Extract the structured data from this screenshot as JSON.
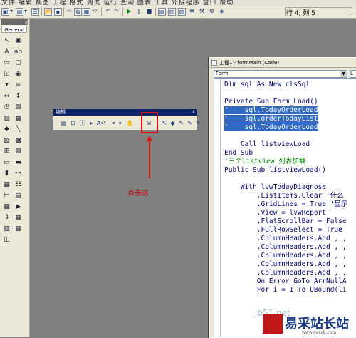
{
  "menubar": {
    "labels": "文件 编辑 视图 工程 格式 调试 运行 查询 图表 工具 外接程序 窗口 帮助"
  },
  "status": {
    "row_col": "行 4, 列 5"
  },
  "toolbox": {
    "tab_label": "General",
    "close_glyph": "×",
    "tools": [
      "pointer",
      "picture",
      "label",
      "textbox",
      "frame",
      "button",
      "checkbox",
      "option",
      "combo",
      "list",
      "hscroll",
      "vscroll",
      "timer",
      "drive",
      "dir",
      "file",
      "shape",
      "line",
      "image",
      "data",
      "ole",
      "common",
      "tab",
      "status",
      "progress",
      "slider",
      "imagelist",
      "listview",
      "treeview",
      "richtext",
      "grid",
      "animation",
      "updown",
      "calendar",
      "mschart",
      "flexgrid",
      "coolbar"
    ]
  },
  "float_toolbar": {
    "title": "编辑",
    "close_glyph": "×",
    "buttons": [
      "list-properties",
      "list-constants",
      "quick-info",
      "param-info",
      "complete-word",
      "indent",
      "outdent",
      "toggle-breakpoint",
      "comment-block",
      "uncomment-block",
      "toggle-bookmark",
      "next-bookmark",
      "prev-bookmark",
      "clear-bookmarks"
    ]
  },
  "annotation": {
    "label": "点击这"
  },
  "code_window": {
    "title": "工程1 - formMain (Code)",
    "object_combo": "Form",
    "proc_combo": "L",
    "lines": [
      {
        "text": "Dim sql As New clsSql",
        "style": "plain"
      },
      {
        "text": "",
        "style": "plain"
      },
      {
        "text": "Private Sub Form_Load()",
        "style": "plain"
      },
      {
        "text": "'    sql.TodayOrderLoad",
        "style": "sel"
      },
      {
        "text": "'    sql.orderTodayList",
        "style": "sel"
      },
      {
        "text": "'    sql.TodayOrderLoad",
        "style": "sel"
      },
      {
        "text": "",
        "style": "plain"
      },
      {
        "text": "    Call listviewLoad",
        "style": "plain"
      },
      {
        "text": "End Sub",
        "style": "plain"
      },
      {
        "text": "'三个listview 列表加载",
        "style": "green"
      },
      {
        "text": "Public Sub listviewLoad()",
        "style": "plain"
      },
      {
        "text": "",
        "style": "plain"
      },
      {
        "text": "    With lvwTodayDiagnose",
        "style": "plain"
      },
      {
        "text": "        .ListItems.Clear '什么",
        "style": "plain"
      },
      {
        "text": "        .GridLines = True '显示",
        "style": "plain"
      },
      {
        "text": "        .View = lvwReport",
        "style": "plain"
      },
      {
        "text": "        .FlatScrollBar = False",
        "style": "plain"
      },
      {
        "text": "        .FullRowSelect = True",
        "style": "plain"
      },
      {
        "text": "        .ColumnHeaders.Add , ,",
        "style": "plain"
      },
      {
        "text": "        .ColumnHeaders.Add , ,",
        "style": "plain"
      },
      {
        "text": "        .ColumnHeaders.Add , ,",
        "style": "plain"
      },
      {
        "text": "        .ColumnHeaders.Add , ,",
        "style": "plain"
      },
      {
        "text": "        .ColumnHeaders.Add , ,",
        "style": "plain"
      },
      {
        "text": "        On Error GoTo ArrNullA",
        "style": "plain"
      },
      {
        "text": "        For i = 1 To UBound(li",
        "style": "plain"
      }
    ]
  },
  "watermark": {
    "text": "jb51.net",
    "logo_text": "易采站长站",
    "logo_url": "www.easck.com"
  }
}
